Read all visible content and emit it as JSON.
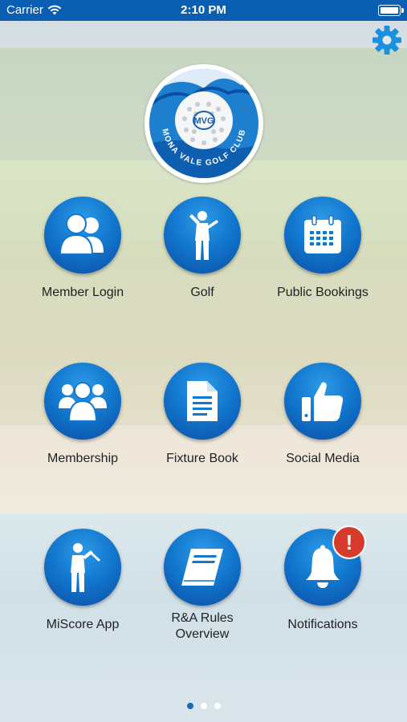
{
  "status_bar": {
    "carrier": "Carrier",
    "time": "2:10 PM"
  },
  "logo": {
    "club_name": "MONA VALE GOLF CLUB",
    "description": "Mona Vale Golf Club crest with golf ball and wave"
  },
  "tiles": [
    {
      "label": "Member Login",
      "icon": "members-icon"
    },
    {
      "label": "Golf",
      "icon": "golfer-icon"
    },
    {
      "label": "Public Bookings",
      "icon": "calendar-icon"
    },
    {
      "label": "Membership",
      "icon": "group-icon"
    },
    {
      "label": "Fixture Book",
      "icon": "document-icon"
    },
    {
      "label": "Social Media",
      "icon": "thumbs-up-icon"
    },
    {
      "label": "MiScore App",
      "icon": "golfer-swing-icon"
    },
    {
      "label_line1": "R&A Rules",
      "label_line2": "Overview",
      "icon": "book-icon"
    },
    {
      "label": "Notifications",
      "icon": "bell-icon",
      "badge": "!"
    }
  ],
  "pager": {
    "pages": 3,
    "current": 1
  },
  "colors": {
    "status_bar": "#0b5fb3",
    "button_blue": "#1278cf",
    "badge_red": "#d63a2b",
    "gear_blue": "#1b8fe0"
  }
}
